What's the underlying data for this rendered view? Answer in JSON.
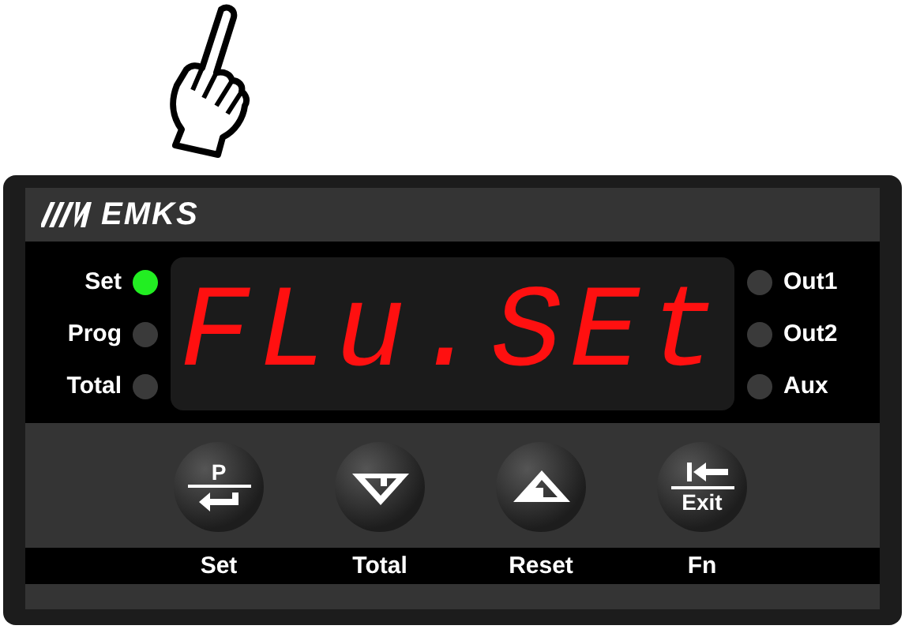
{
  "brand": "EMKS",
  "left_indicators": [
    {
      "label": "Set",
      "on": true
    },
    {
      "label": "Prog",
      "on": false
    },
    {
      "label": "Total",
      "on": false
    }
  ],
  "display": "FLu.SEt",
  "right_indicators": [
    {
      "label": "Out1",
      "on": false
    },
    {
      "label": "Out2",
      "on": false
    },
    {
      "label": "Aux",
      "on": false
    }
  ],
  "keys": [
    {
      "kind": "prog",
      "text": "P",
      "caption": "Set"
    },
    {
      "kind": "down",
      "caption": "Total"
    },
    {
      "kind": "up",
      "caption": "Reset"
    },
    {
      "kind": "exit",
      "text": "Exit",
      "caption": "Fn"
    }
  ]
}
